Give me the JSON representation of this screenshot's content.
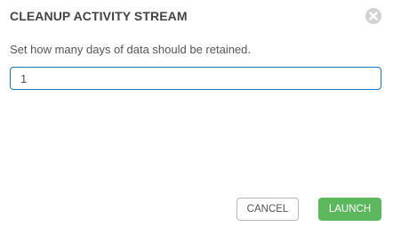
{
  "dialog": {
    "title": "CLEANUP ACTIVITY STREAM",
    "close_icon": "close-circle-icon",
    "help_text": "Set how many days of data should be retained.",
    "days_field": {
      "value": "1",
      "placeholder": ""
    },
    "buttons": {
      "cancel_label": "CANCEL",
      "launch_label": "LAUNCH"
    },
    "colors": {
      "accent_border": "#1678c2",
      "launch_bg": "#5cb85c",
      "close_bg": "#d2d2d2"
    }
  }
}
